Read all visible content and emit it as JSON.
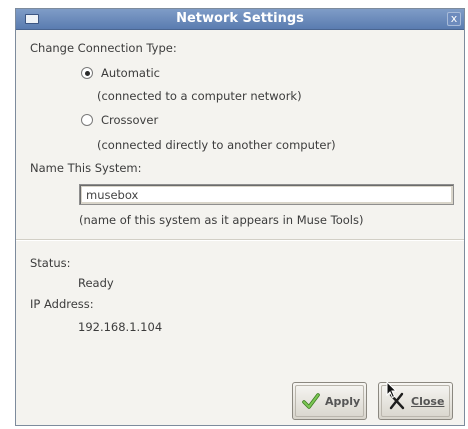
{
  "window": {
    "title": "Network Settings",
    "close_glyph": "x"
  },
  "connection": {
    "label": "Change Connection Type:",
    "options": [
      {
        "label": "Automatic",
        "description": "(connected to a computer network)",
        "selected": true
      },
      {
        "label": "Crossover",
        "description": "(connected directly to another computer)",
        "selected": false
      }
    ]
  },
  "system_name": {
    "label": "Name This System:",
    "value": "musebox",
    "hint": "(name of this system as it appears in Muse Tools)"
  },
  "status": {
    "label": "Status:",
    "value": "Ready"
  },
  "ip": {
    "label": "IP Address:",
    "value": "192.168.1.104"
  },
  "buttons": {
    "apply_label": "Apply",
    "close_label": "Close"
  },
  "icons": {
    "apply": "checkmark-icon",
    "close": "x-mark-icon",
    "window_menu": "window-menu-icon",
    "cursor": "mouse-pointer-icon"
  },
  "colors": {
    "titlebar": "#6b8bbd",
    "apply_check": "#5aa83a",
    "background": "#f4f3ef"
  }
}
